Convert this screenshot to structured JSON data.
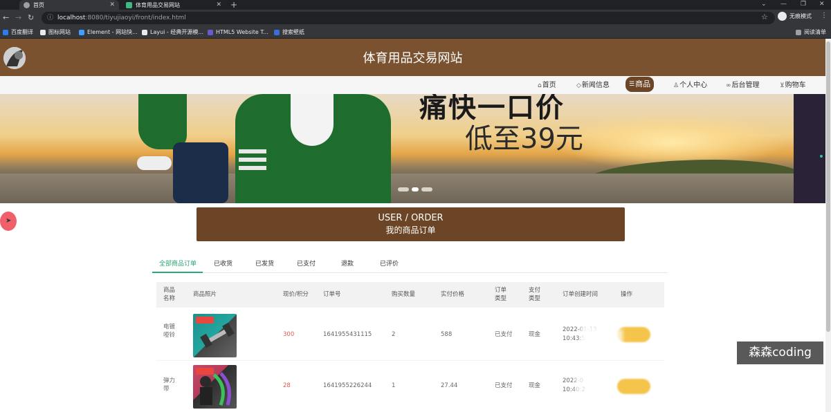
{
  "browser": {
    "tabs": [
      {
        "title": "首页",
        "active": true
      },
      {
        "title": "体育用品交易网站",
        "active": false
      }
    ],
    "new_tab": "+",
    "url": {
      "host": "localhost",
      "path": ":8080/tiyujiaoyi/front/index.html"
    },
    "profile": "无痕模式",
    "bookmarks": [
      {
        "label": "百度翻译",
        "color": "#2f7bea"
      },
      {
        "label": "图标网站",
        "color": "#e8eaed"
      },
      {
        "label": "Element - 网站快...",
        "color": "#409eff"
      },
      {
        "label": "Layui - 经典开源模...",
        "color": "#e8eaed"
      },
      {
        "label": "HTML5 Website T...",
        "color": "#6a5acd"
      },
      {
        "label": "搜索壁纸",
        "color": "#3b6fd8"
      }
    ],
    "reading_list": "阅读清单"
  },
  "site": {
    "title": "体育用品交易网站",
    "nav": [
      {
        "label": "首页",
        "icon": "home-icon",
        "active": false
      },
      {
        "label": "新闻信息",
        "icon": "tag-icon",
        "active": false
      },
      {
        "label": "商品",
        "icon": "list-icon",
        "active": true
      },
      {
        "label": "个人中心",
        "icon": "user-icon",
        "active": false
      },
      {
        "label": "后台管理",
        "icon": "link-icon",
        "active": false
      },
      {
        "label": "购物车",
        "icon": "cart-icon",
        "active": false
      }
    ],
    "banner": {
      "headline": "痛快一口价",
      "subline": "低至39元"
    }
  },
  "order_section": {
    "title_en": "USER / ORDER",
    "title_cn": "我的商品订单",
    "tabs": [
      "全部商品订单",
      "已收货",
      "已发货",
      "已支付",
      "退款",
      "已评价"
    ],
    "active_tab": "全部商品订单",
    "columns": [
      "商品名称",
      "商品照片",
      "现价/积分",
      "订单号",
      "购买数量",
      "实付价格",
      "订单类型",
      "支付类型",
      "订单创建时间",
      "操作"
    ],
    "rows": [
      {
        "name": "电镀哑铃",
        "price": "300",
        "order_no": "1641955431115",
        "qty": "2",
        "paid": "588",
        "order_type": "已支付",
        "pay_type": "现金",
        "created": "2022-01-13",
        "created_time": "10:43:5"
      },
      {
        "name": "弹力带",
        "price": "28",
        "order_no": "1641955226244",
        "qty": "1",
        "paid": "27.44",
        "order_type": "已支付",
        "pay_type": "现金",
        "created": "2022-0",
        "created_time": "10:40:2"
      }
    ]
  },
  "watermark": "森森coding"
}
